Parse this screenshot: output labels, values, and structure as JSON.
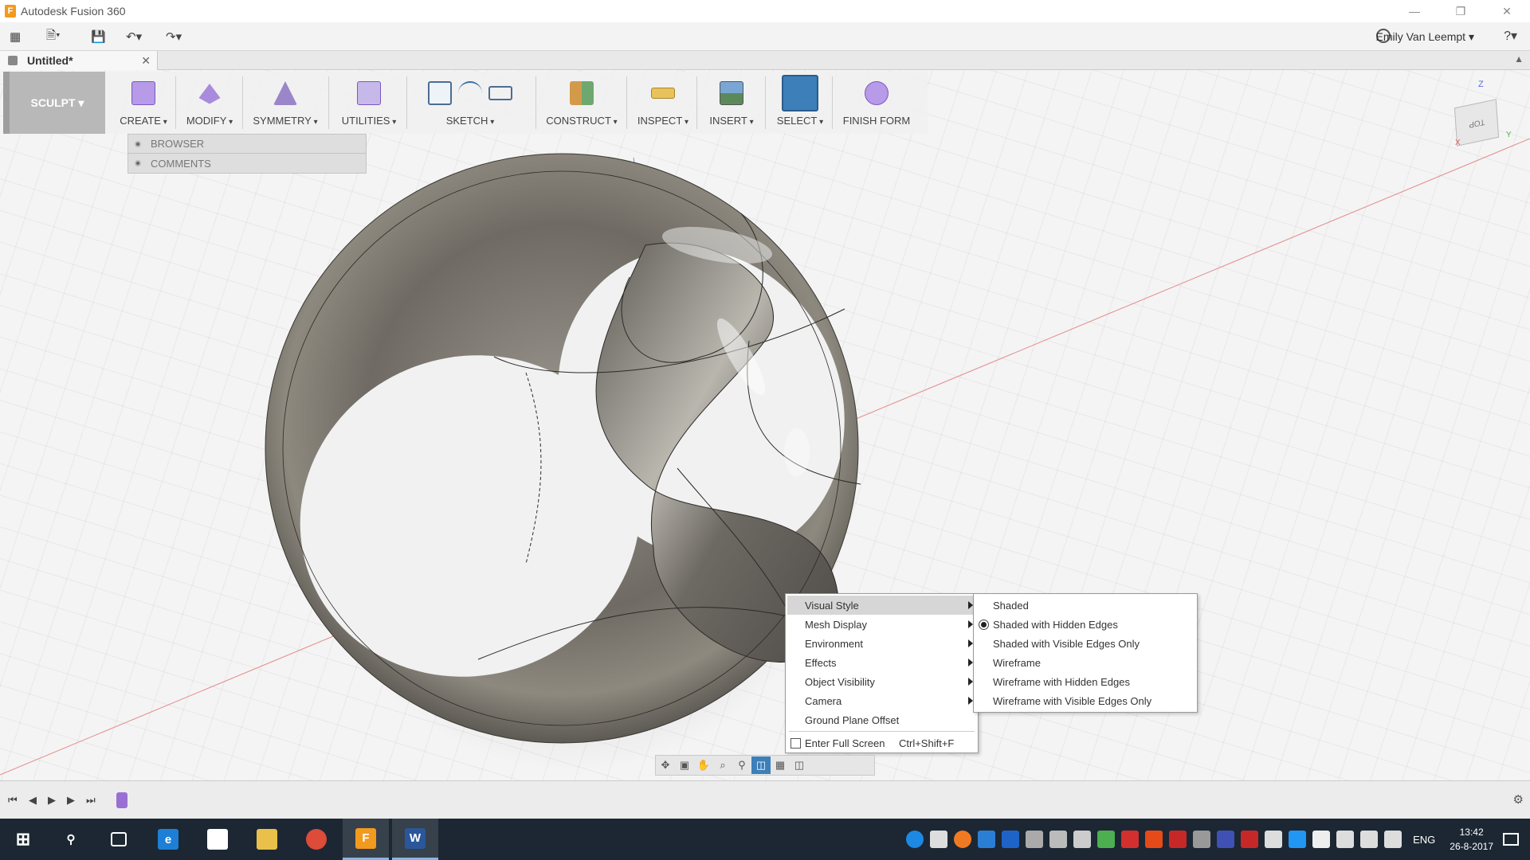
{
  "window": {
    "title": "Autodesk Fusion 360"
  },
  "quick_access": {
    "user_name": "Emily Van Leempt",
    "help_label": "?"
  },
  "document_tab": {
    "label": "Untitled*"
  },
  "toolbar": {
    "workspace": "SCULPT",
    "tools": {
      "create": "CREATE",
      "modify": "MODIFY",
      "symmetry": "SYMMETRY",
      "utilities": "UTILITIES",
      "sketch": "SKETCH",
      "construct": "CONSTRUCT",
      "inspect": "INSPECT",
      "insert": "INSERT",
      "select": "SELECT",
      "finish_form": "FINISH FORM"
    }
  },
  "browser_panel": {
    "browser": "BROWSER",
    "comments": "COMMENTS"
  },
  "viewcube": {
    "face": "TOP",
    "axis_x": "X",
    "axis_y": "Y",
    "axis_z": "Z"
  },
  "context_menu": {
    "items": [
      {
        "label": "Visual Style"
      },
      {
        "label": "Mesh Display"
      },
      {
        "label": "Environment"
      },
      {
        "label": "Effects"
      },
      {
        "label": "Object Visibility"
      },
      {
        "label": "Camera"
      },
      {
        "label": "Ground Plane Offset"
      }
    ],
    "full_screen": {
      "label": "Enter Full Screen",
      "shortcut": "Ctrl+Shift+F"
    }
  },
  "visual_style_submenu": {
    "items": [
      {
        "label": "Shaded"
      },
      {
        "label": "Shaded with Hidden Edges"
      },
      {
        "label": "Shaded with Visible Edges Only"
      },
      {
        "label": "Wireframe"
      },
      {
        "label": "Wireframe with Hidden Edges"
      },
      {
        "label": "Wireframe with Visible Edges Only"
      }
    ],
    "selected": "Shaded with Hidden Edges"
  },
  "taskbar": {
    "language": "ENG",
    "time": "13:42",
    "date": "26-8-2017"
  },
  "colors": {
    "accent": "#3d7fb9",
    "taskbar": "#1c2733",
    "workspace_button": "#b8b8b8"
  }
}
